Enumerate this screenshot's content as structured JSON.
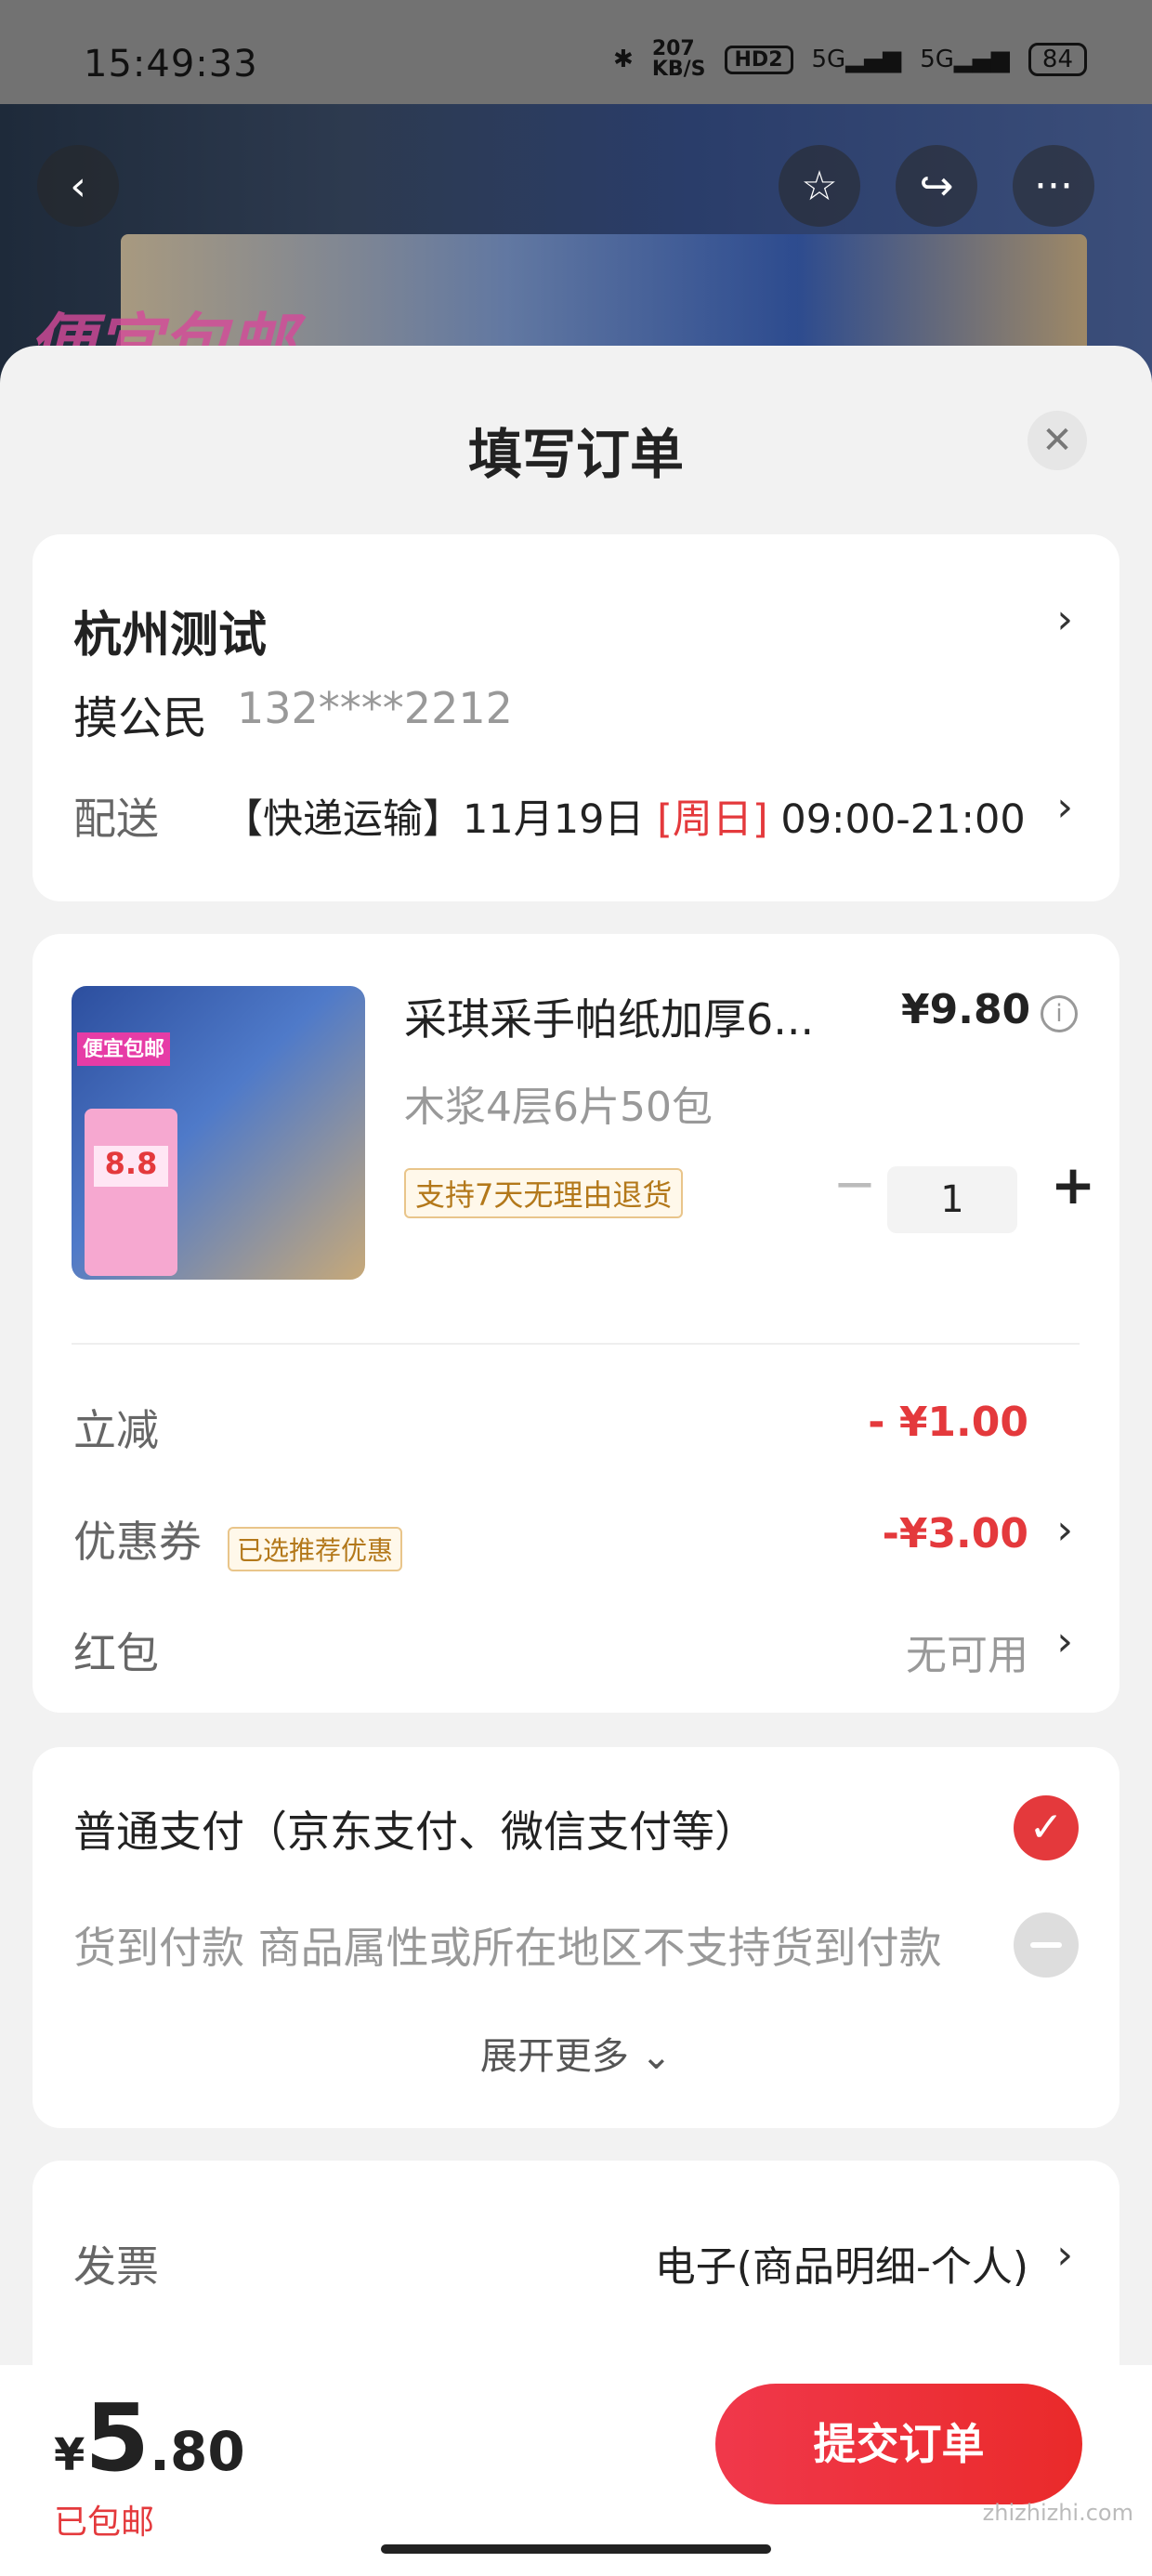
{
  "status_bar": {
    "time": "15:49:33",
    "net_speed": "207\nKB/S",
    "hd": "HD2",
    "sig1": "5G",
    "sig2": "5G",
    "battery": "84"
  },
  "hero": {
    "promo_text": "便宜包邮"
  },
  "sheet": {
    "title": "填写订单"
  },
  "address": {
    "title": "杭州测试",
    "name": "摸公民",
    "phone": "132****2212",
    "shipping_label": "配送",
    "shipping_method": "【快递运输】11月19日",
    "shipping_day": "[周日]",
    "shipping_time": "09:00-21:00"
  },
  "product": {
    "name": "采琪采手帕纸加厚6...",
    "price": "¥9.80",
    "spec": "木浆4层6片50包",
    "return_badge": "支持7天无理由退货",
    "quantity": "1",
    "thumb_tag": "便宜包邮",
    "thumb_price": "8.8"
  },
  "discounts": [
    {
      "label": "立减",
      "value": "- ¥1.00"
    },
    {
      "label": "优惠券",
      "badge": "已选推荐优惠",
      "value": "-¥3.00"
    },
    {
      "label": "红包",
      "value": "无可用"
    }
  ],
  "payment": {
    "normal": "普通支付（京东支付、微信支付等）",
    "cod": "货到付款 商品属性或所在地区不支持货到付款",
    "expand": "展开更多 ⌄"
  },
  "invoice": {
    "label": "发票",
    "value": "电子(商品明细-个人)"
  },
  "bottom": {
    "currency": "¥",
    "total_int": "5",
    "total_dec": ".80",
    "shipping_note": "已包邮",
    "submit": "提交订单"
  },
  "watermark": "zhizhizhi.com"
}
